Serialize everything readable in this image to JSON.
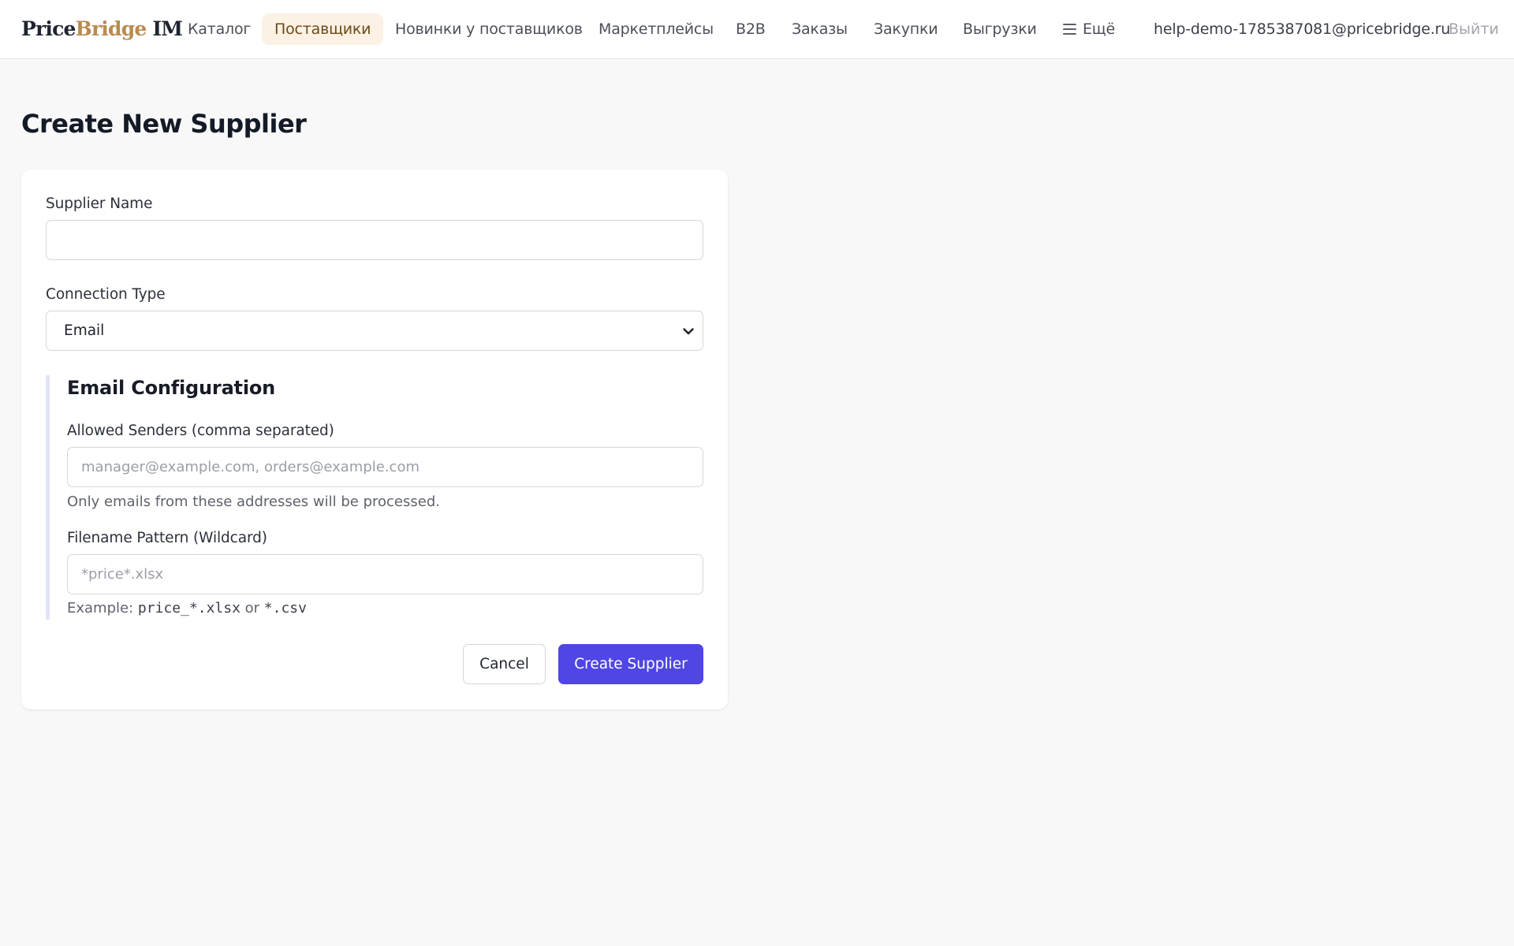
{
  "brand": {
    "part1": "Price",
    "part2": "Bridge",
    "part3": " IM"
  },
  "nav": {
    "items": [
      {
        "label": "Каталог"
      },
      {
        "label": "Поставщики",
        "active": true
      },
      {
        "label": "Новинки у поставщиков"
      },
      {
        "label": "Маркетплейсы"
      },
      {
        "label": "B2B"
      },
      {
        "label": "Заказы"
      },
      {
        "label": "Закупки"
      },
      {
        "label": "Выгрузки"
      }
    ],
    "more_label": "Ещё",
    "more_icon": "menu-icon",
    "user_email": "help-demo-1785387081@pricebridge.ru",
    "logout_label": "Выйти"
  },
  "page": {
    "title": "Create New Supplier"
  },
  "form": {
    "supplier_name": {
      "label": "Supplier Name",
      "value": "",
      "placeholder": ""
    },
    "connection_type": {
      "label": "Connection Type",
      "selected": "Email"
    },
    "email_config": {
      "title": "Email Configuration",
      "allowed_senders": {
        "label": "Allowed Senders (comma separated)",
        "value": "",
        "placeholder": "manager@example.com, orders@example.com",
        "help": "Only emails from these addresses will be processed."
      },
      "filename_pattern": {
        "label": "Filename Pattern (Wildcard)",
        "value": "",
        "placeholder": "*price*.xlsx",
        "help_prefix": "Example: ",
        "help_code1": "price_*.xlsx",
        "help_mid": " or ",
        "help_code2": "*.csv"
      }
    },
    "cancel_label": "Cancel",
    "submit_label": "Create Supplier"
  },
  "colors": {
    "accent": "#4f46e5",
    "brand_gold": "#b98b4f",
    "active_nav_bg": "#fbf1e4",
    "section_bar": "#e1e3fb"
  }
}
